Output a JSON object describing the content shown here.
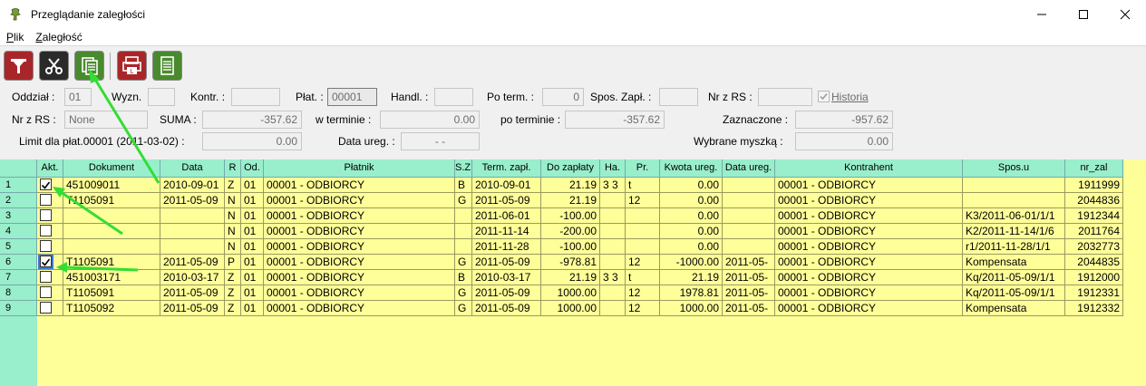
{
  "window": {
    "title": "Przeglądanie zaległości"
  },
  "menu": {
    "plik": "Plik",
    "plik_key": "P",
    "plik_rest": "lik",
    "zaleglosc_key": "Z",
    "zaleglosc_rest": "aległość"
  },
  "colors": {
    "grid_bg": "#ffff99",
    "header_bg": "#99eecc",
    "arrow": "#33dd33"
  },
  "filters": {
    "oddzial_label": "Oddział :",
    "oddzial": "01",
    "wyzn_label": "Wyzn.",
    "wyzn": "",
    "kontr_label": "Kontr. :",
    "kontr": "",
    "plat_label": "Płat. :",
    "plat": "00001",
    "handl_label": "Handl. :",
    "handl": "",
    "poterm_label": "Po term. :",
    "poterm": "0",
    "spos_label": "Spos. Zapł. :",
    "spos": "",
    "nrzrs_label": "Nr z RS :",
    "nrzrs": "",
    "historia_label": "Historia",
    "nrzrs2_label": "Nr z RS :",
    "nrzrs2": "None",
    "suma_label": "SUMA :",
    "suma": "-357.62",
    "wterminie_label": "w terminie :",
    "wterminie": "0.00",
    "poterminie_label": "po terminie :",
    "poterminie": "-357.62",
    "zaznaczone_label": "Zaznaczone :",
    "zaznaczone": "-957.62",
    "limit_label": "Limit dla płat.00001  (2011-03-02) :",
    "limit": "0.00",
    "dataureg_label": "Data ureg. :",
    "dataureg": "-  -",
    "wybrane_label": "Wybrane myszką :",
    "wybrane": "0.00"
  },
  "grid": {
    "headers": [
      "Akt.",
      "Dokument",
      "Data",
      "R",
      "Od.",
      "Płatnik",
      "S.Z.",
      "Term. zapł.",
      "Do zapłaty",
      "Ha.",
      "Pr.",
      "Kwota ureg.",
      "Data ureg.",
      "Kontrahent",
      "Spos.u",
      "nr_zal"
    ],
    "rows": [
      {
        "n": "1",
        "akt": true,
        "dok": "451009011",
        "data": "2010-09-01",
        "r": "Z",
        "od": "01",
        "plat": "00001 - ODBIORCY",
        "sz": "B",
        "term": "2010-09-01",
        "doz": "21.19",
        "ha": "3 3",
        "pr": "t",
        "kwota": "0.00",
        "dureg": "",
        "kontr": "00001 - ODBIORCY",
        "spos": "",
        "nr": "1911999"
      },
      {
        "n": "2",
        "akt": false,
        "dok": "T1105091",
        "data": "2011-05-09",
        "r": "N",
        "od": "01",
        "plat": "00001 - ODBIORCY",
        "sz": "G",
        "term": "2011-05-09",
        "doz": "21.19",
        "ha": "",
        "pr": "12",
        "kwota": "0.00",
        "dureg": "",
        "kontr": "00001 - ODBIORCY",
        "spos": "",
        "nr": "2044836"
      },
      {
        "n": "3",
        "akt": false,
        "dok": "",
        "data": "",
        "r": "N",
        "od": "01",
        "plat": "00001 - ODBIORCY",
        "sz": "",
        "term": "2011-06-01",
        "doz": "-100.00",
        "ha": "",
        "pr": "",
        "kwota": "0.00",
        "dureg": "",
        "kontr": "00001 - ODBIORCY",
        "spos": "K3/2011-06-01/1/1",
        "nr": "1912344"
      },
      {
        "n": "4",
        "akt": false,
        "dok": "",
        "data": "",
        "r": "N",
        "od": "01",
        "plat": "00001 - ODBIORCY",
        "sz": "",
        "term": "2011-11-14",
        "doz": "-200.00",
        "ha": "",
        "pr": "",
        "kwota": "0.00",
        "dureg": "",
        "kontr": "00001 - ODBIORCY",
        "spos": "K2/2011-11-14/1/6",
        "nr": "2011764"
      },
      {
        "n": "5",
        "akt": false,
        "dok": "",
        "data": "",
        "r": "N",
        "od": "01",
        "plat": "00001 - ODBIORCY",
        "sz": "",
        "term": "2011-11-28",
        "doz": "-100.00",
        "ha": "",
        "pr": "",
        "kwota": "0.00",
        "dureg": "",
        "kontr": "00001 - ODBIORCY",
        "spos": "r1/2011-11-28/1/1",
        "nr": "2032773"
      },
      {
        "n": "6",
        "akt": true,
        "dok": "T1105091",
        "data": "2011-05-09",
        "r": "P",
        "od": "01",
        "plat": "00001 - ODBIORCY",
        "sz": "G",
        "term": "2011-05-09",
        "doz": "-978.81",
        "ha": "",
        "pr": "12",
        "kwota": "-1000.00",
        "dureg": "2011-05-",
        "kontr": "00001 - ODBIORCY",
        "spos": "Kompensata",
        "nr": "2044835"
      },
      {
        "n": "7",
        "akt": false,
        "dok": "451003171",
        "data": "2010-03-17",
        "r": "Z",
        "od": "01",
        "plat": "00001 - ODBIORCY",
        "sz": "B",
        "term": "2010-03-17",
        "doz": "21.19",
        "ha": "3 3",
        "pr": "t",
        "kwota": "21.19",
        "dureg": "2011-05-",
        "kontr": "00001 - ODBIORCY",
        "spos": "Kq/2011-05-09/1/1",
        "nr": "1912000"
      },
      {
        "n": "8",
        "akt": false,
        "dok": "T1105091",
        "data": "2011-05-09",
        "r": "Z",
        "od": "01",
        "plat": "00001 - ODBIORCY",
        "sz": "G",
        "term": "2011-05-09",
        "doz": "1000.00",
        "ha": "",
        "pr": "12",
        "kwota": "1978.81",
        "dureg": "2011-05-",
        "kontr": "00001 - ODBIORCY",
        "spos": "Kq/2011-05-09/1/1",
        "nr": "1912331"
      },
      {
        "n": "9",
        "akt": false,
        "dok": "T1105092",
        "data": "2011-05-09",
        "r": "Z",
        "od": "01",
        "plat": "00001 - ODBIORCY",
        "sz": "G",
        "term": "2011-05-09",
        "doz": "1000.00",
        "ha": "",
        "pr": "12",
        "kwota": "1000.00",
        "dureg": "2011-05-",
        "kontr": "00001 - ODBIORCY",
        "spos": "Kompensata",
        "nr": "1912332"
      }
    ]
  }
}
